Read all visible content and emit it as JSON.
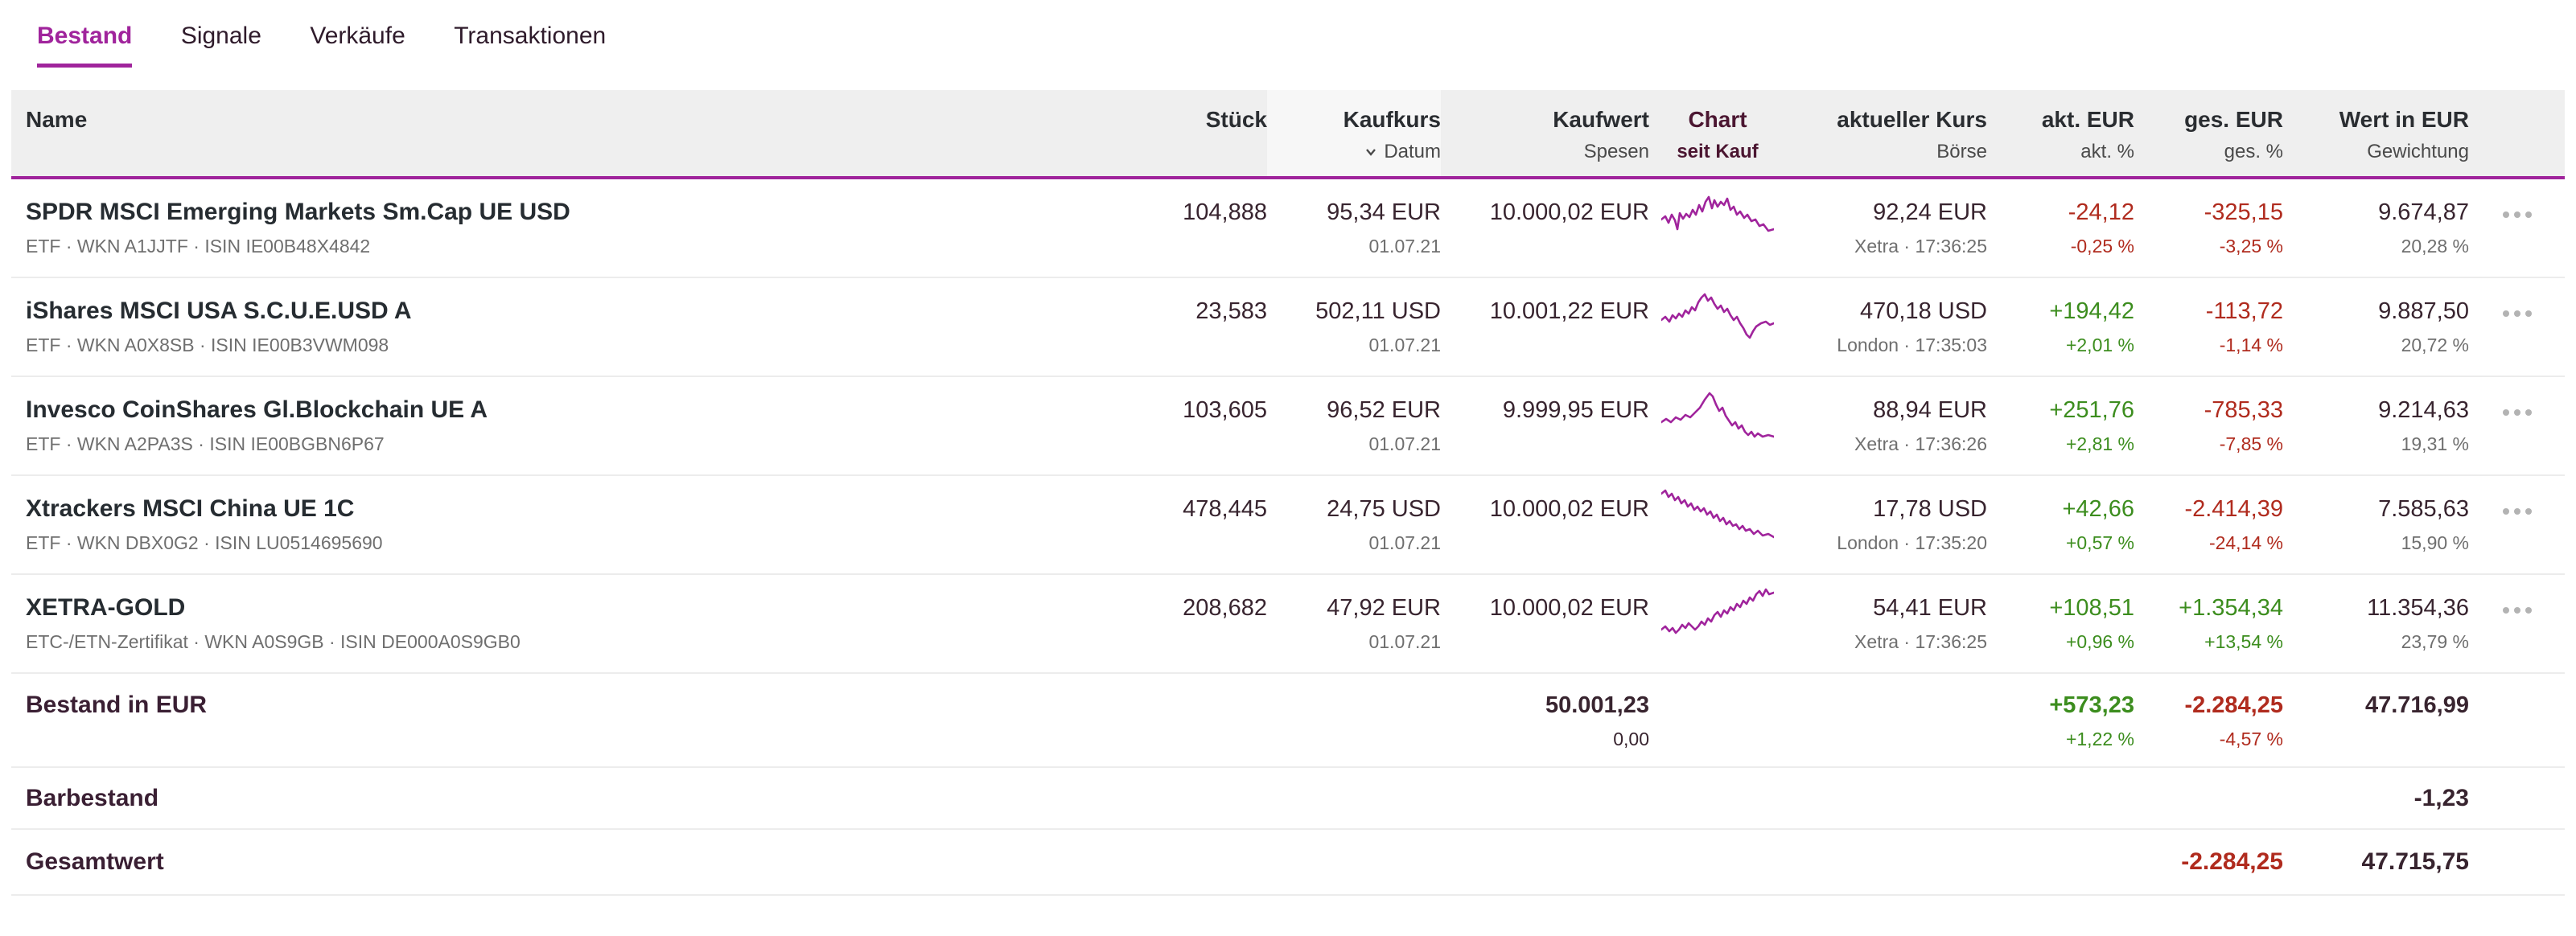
{
  "colors": {
    "accent": "#a0249c",
    "pos": "#3c8d1e",
    "neg": "#b02b1e"
  },
  "icons": {
    "sort": "chevron-down",
    "row_menu": "three-dots-more-options"
  },
  "tabs": [
    {
      "label": "Bestand",
      "active": true
    },
    {
      "label": "Signale",
      "active": false
    },
    {
      "label": "Verkäufe",
      "active": false
    },
    {
      "label": "Transaktionen",
      "active": false
    }
  ],
  "header": {
    "name": "Name",
    "stueck": "Stück",
    "kaufkurs": "Kaufkurs",
    "kaufkurs_sub": "Datum",
    "kaufwert": "Kaufwert",
    "kaufwert_sub": "Spesen",
    "chart": "Chart",
    "chart_sub": "seit Kauf",
    "kurs": "aktueller Kurs",
    "kurs_sub": "Börse",
    "akt": "akt. EUR",
    "akt_sub": "akt. %",
    "ges": "ges. EUR",
    "ges_sub": "ges. %",
    "wert": "Wert in EUR",
    "wert_sub": "Gewichtung"
  },
  "rows": [
    {
      "name": "SPDR MSCI Emerging Markets Sm.Cap UE USD",
      "details": "ETF · WKN A1JJTF · ISIN IE00B48X4842",
      "stueck": "104,888",
      "kaufkurs": "95,34 EUR",
      "datum": "01.07.21",
      "kaufwert": "10.000,02 EUR",
      "kurs": "92,24 EUR",
      "boerse": "Xetra · 17:36:25",
      "akt": "-24,12",
      "akt_pct": "-0,25 %",
      "akt_dir": "neg",
      "ges": "-325,15",
      "ges_pct": "-3,25 %",
      "ges_dir": "neg",
      "wert": "9.674,87",
      "gewichtung": "20,28 %",
      "sparkline": [
        [
          0,
          34
        ],
        [
          5,
          30
        ],
        [
          9,
          38
        ],
        [
          13,
          28
        ],
        [
          17,
          35
        ],
        [
          20,
          46
        ],
        [
          23,
          26
        ],
        [
          27,
          33
        ],
        [
          31,
          27
        ],
        [
          35,
          31
        ],
        [
          39,
          22
        ],
        [
          43,
          28
        ],
        [
          47,
          16
        ],
        [
          51,
          24
        ],
        [
          55,
          12
        ],
        [
          59,
          6
        ],
        [
          63,
          20
        ],
        [
          66,
          10
        ],
        [
          70,
          18
        ],
        [
          74,
          12
        ],
        [
          78,
          16
        ],
        [
          82,
          8
        ],
        [
          86,
          22
        ],
        [
          90,
          18
        ],
        [
          94,
          28
        ],
        [
          98,
          24
        ],
        [
          103,
          32
        ],
        [
          107,
          28
        ],
        [
          112,
          36
        ],
        [
          117,
          34
        ],
        [
          122,
          42
        ],
        [
          127,
          40
        ],
        [
          133,
          48
        ],
        [
          140,
          46
        ]
      ]
    },
    {
      "name": "iShares MSCI USA S.C.U.E.USD A",
      "details": "ETF · WKN A0X8SB · ISIN IE00B3VWM098",
      "stueck": "23,583",
      "kaufkurs": "502,11 USD",
      "datum": "01.07.21",
      "kaufwert": "10.001,22 EUR",
      "kurs": "470,18 USD",
      "boerse": "London · 17:35:03",
      "akt": "+194,42",
      "akt_pct": "+2,01 %",
      "akt_dir": "pos",
      "ges": "-113,72",
      "ges_pct": "-1,14 %",
      "ges_dir": "neg",
      "wert": "9.887,50",
      "gewichtung": "20,72 %",
      "sparkline": [
        [
          0,
          36
        ],
        [
          5,
          32
        ],
        [
          10,
          38
        ],
        [
          14,
          30
        ],
        [
          18,
          34
        ],
        [
          22,
          28
        ],
        [
          26,
          32
        ],
        [
          30,
          24
        ],
        [
          34,
          28
        ],
        [
          38,
          20
        ],
        [
          42,
          24
        ],
        [
          46,
          14
        ],
        [
          50,
          8
        ],
        [
          54,
          4
        ],
        [
          58,
          12
        ],
        [
          62,
          8
        ],
        [
          66,
          16
        ],
        [
          70,
          22
        ],
        [
          74,
          18
        ],
        [
          78,
          26
        ],
        [
          82,
          22
        ],
        [
          86,
          30
        ],
        [
          90,
          36
        ],
        [
          94,
          32
        ],
        [
          98,
          40
        ],
        [
          102,
          46
        ],
        [
          106,
          54
        ],
        [
          110,
          58
        ],
        [
          114,
          50
        ],
        [
          118,
          44
        ],
        [
          124,
          40
        ],
        [
          130,
          38
        ],
        [
          135,
          42
        ],
        [
          140,
          40
        ]
      ]
    },
    {
      "name": "Invesco CoinShares Gl.Blockchain UE A",
      "details": "ETF · WKN A2PA3S · ISIN IE00BGBN6P67",
      "stueck": "103,605",
      "kaufkurs": "96,52 EUR",
      "datum": "01.07.21",
      "kaufwert": "9.999,95 EUR",
      "kurs": "88,94 EUR",
      "boerse": "Xetra · 17:36:26",
      "akt": "+251,76",
      "akt_pct": "+2,81 %",
      "akt_dir": "pos",
      "ges": "-785,33",
      "ges_pct": "-7,85 %",
      "ges_dir": "neg",
      "wert": "9.214,63",
      "gewichtung": "19,31 %",
      "sparkline": [
        [
          0,
          40
        ],
        [
          6,
          36
        ],
        [
          12,
          40
        ],
        [
          18,
          34
        ],
        [
          24,
          37
        ],
        [
          30,
          31
        ],
        [
          36,
          34
        ],
        [
          42,
          28
        ],
        [
          48,
          22
        ],
        [
          54,
          12
        ],
        [
          60,
          4
        ],
        [
          64,
          8
        ],
        [
          68,
          18
        ],
        [
          72,
          26
        ],
        [
          76,
          22
        ],
        [
          80,
          32
        ],
        [
          84,
          38
        ],
        [
          88,
          44
        ],
        [
          92,
          40
        ],
        [
          96,
          48
        ],
        [
          100,
          44
        ],
        [
          104,
          52
        ],
        [
          108,
          56
        ],
        [
          112,
          52
        ],
        [
          116,
          58
        ],
        [
          120,
          54
        ],
        [
          126,
          58
        ],
        [
          133,
          56
        ],
        [
          140,
          58
        ]
      ]
    },
    {
      "name": "Xtrackers MSCI China UE 1C",
      "details": "ETF · WKN DBX0G2 · ISIN LU0514695690",
      "stueck": "478,445",
      "kaufkurs": "24,75 USD",
      "datum": "01.07.21",
      "kaufwert": "10.000,02 EUR",
      "kurs": "17,78 USD",
      "boerse": "London · 17:35:20",
      "akt": "+42,66",
      "akt_pct": "+0,57 %",
      "akt_dir": "pos",
      "ges": "-2.414,39",
      "ges_pct": "-24,14 %",
      "ges_dir": "neg",
      "wert": "7.585,63",
      "gewichtung": "15,90 %",
      "sparkline": [
        [
          0,
          6
        ],
        [
          5,
          2
        ],
        [
          9,
          10
        ],
        [
          13,
          6
        ],
        [
          17,
          14
        ],
        [
          21,
          10
        ],
        [
          25,
          18
        ],
        [
          29,
          14
        ],
        [
          33,
          22
        ],
        [
          37,
          18
        ],
        [
          41,
          26
        ],
        [
          45,
          22
        ],
        [
          49,
          28
        ],
        [
          53,
          24
        ],
        [
          57,
          32
        ],
        [
          61,
          28
        ],
        [
          65,
          36
        ],
        [
          69,
          32
        ],
        [
          73,
          40
        ],
        [
          77,
          36
        ],
        [
          81,
          44
        ],
        [
          85,
          40
        ],
        [
          89,
          46
        ],
        [
          93,
          44
        ],
        [
          97,
          50
        ],
        [
          101,
          46
        ],
        [
          105,
          52
        ],
        [
          110,
          50
        ],
        [
          115,
          56
        ],
        [
          120,
          52
        ],
        [
          126,
          58
        ],
        [
          133,
          56
        ],
        [
          140,
          60
        ]
      ]
    },
    {
      "name": "XETRA-GOLD",
      "details": "ETC-/ETN-Zertifikat · WKN A0S9GB · ISIN DE000A0S9GB0",
      "stueck": "208,682",
      "kaufkurs": "47,92 EUR",
      "datum": "01.07.21",
      "kaufwert": "10.000,02 EUR",
      "kurs": "54,41 EUR",
      "boerse": "Xetra · 17:36:25",
      "akt": "+108,51",
      "akt_pct": "+0,96 %",
      "akt_dir": "pos",
      "ges": "+1.354,34",
      "ges_pct": "+13,54 %",
      "ges_dir": "pos",
      "wert": "11.354,36",
      "gewichtung": "23,79 %",
      "sparkline": [
        [
          0,
          52
        ],
        [
          5,
          48
        ],
        [
          10,
          54
        ],
        [
          14,
          50
        ],
        [
          18,
          56
        ],
        [
          22,
          52
        ],
        [
          26,
          46
        ],
        [
          30,
          50
        ],
        [
          34,
          44
        ],
        [
          38,
          48
        ],
        [
          42,
          52
        ],
        [
          46,
          48
        ],
        [
          50,
          42
        ],
        [
          54,
          46
        ],
        [
          58,
          38
        ],
        [
          62,
          42
        ],
        [
          66,
          34
        ],
        [
          70,
          30
        ],
        [
          74,
          36
        ],
        [
          78,
          28
        ],
        [
          82,
          32
        ],
        [
          86,
          24
        ],
        [
          90,
          28
        ],
        [
          94,
          20
        ],
        [
          98,
          24
        ],
        [
          102,
          16
        ],
        [
          106,
          20
        ],
        [
          110,
          12
        ],
        [
          114,
          16
        ],
        [
          118,
          8
        ],
        [
          122,
          4
        ],
        [
          126,
          10
        ],
        [
          130,
          2
        ],
        [
          134,
          8
        ],
        [
          140,
          6
        ]
      ]
    }
  ],
  "summary": {
    "bestand": {
      "label": "Bestand in EUR",
      "kaufwert": "50.001,23",
      "spesen": "0,00",
      "akt": "+573,23",
      "akt_pct": "+1,22 %",
      "akt_dir": "pos",
      "ges": "-2.284,25",
      "ges_pct": "-4,57 %",
      "ges_dir": "neg",
      "wert": "47.716,99"
    },
    "barbestand": {
      "label": "Barbestand",
      "wert": "-1,23"
    },
    "gesamtwert": {
      "label": "Gesamtwert",
      "ges": "-2.284,25",
      "ges_dir": "neg",
      "wert": "47.715,75"
    }
  }
}
